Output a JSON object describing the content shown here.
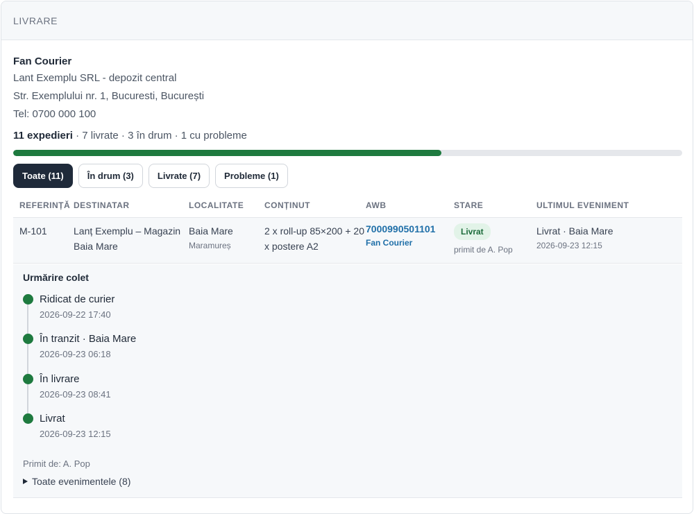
{
  "header": {
    "title": "LIVRARE"
  },
  "carrier": {
    "name": "Fan Courier",
    "address_lines": [
      "Lant Exemplu SRL - depozit central",
      "Str. Exemplului nr. 1, Bucuresti, București",
      "Tel: 0700 000 100"
    ]
  },
  "summary": {
    "total": "11 expedieri",
    "rest": " · 7 livrate · 3 în drum · 1 cu probleme",
    "progress_fraction": 0.64
  },
  "filters": [
    {
      "label": "Toate (11)",
      "active": true
    },
    {
      "label": "În drum (3)",
      "active": false
    },
    {
      "label": "Livrate (7)",
      "active": false
    },
    {
      "label": "Probleme (1)",
      "active": false
    }
  ],
  "table": {
    "columns": [
      "Referință",
      "Destinatar",
      "Localitate",
      "Conținut",
      "AWB",
      "Stare",
      "Ultimul eveniment"
    ],
    "rows": [
      {
        "ref": "M-101",
        "recipient": "Lanț Exemplu – Magazin Baia Mare",
        "city": "Baia Mare",
        "county": "Maramureș",
        "content": "2 x roll-up 85×200 + 20 x postere A2",
        "awb": "7000990501101",
        "awb_carrier": "Fan Courier",
        "status": "Livrat",
        "status_sub": "primit de A. Pop",
        "last_event": "Livrat · Baia Mare",
        "last_event_time": "2026-09-23 12:15"
      }
    ]
  },
  "tracking": {
    "title": "Urmărire colet",
    "events": [
      {
        "label": "Ridicat de curier",
        "time": "2026-09-22 17:40"
      },
      {
        "label": "În tranzit · Baia Mare",
        "time": "2026-09-23 06:18"
      },
      {
        "label": "În livrare",
        "time": "2026-09-23 08:41"
      },
      {
        "label": "Livrat",
        "time": "2026-09-23 12:15"
      }
    ],
    "received_by": "Primit de: A. Pop",
    "all_events_label": "Toate evenimentele (8)"
  },
  "colors": {
    "accent_green": "#1e7a3f",
    "link_blue": "#1f6fa8",
    "chip_active": "#1f2a3a"
  }
}
